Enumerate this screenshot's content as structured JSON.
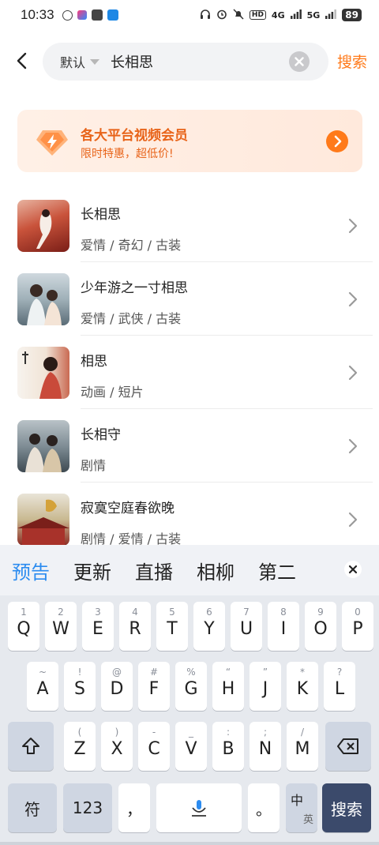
{
  "status": {
    "time": "10:33",
    "network1": "4G",
    "network2": "5G",
    "battery": "89"
  },
  "header": {
    "filter_label": "默认",
    "query": "长相思",
    "search_label": "搜索"
  },
  "banner": {
    "title": "各大平台视频会员",
    "subtitle": "限时特惠，超低价!"
  },
  "results": [
    {
      "title": "长相思",
      "tags": "爱情 / 奇幻 / 古装"
    },
    {
      "title": "少年游之一寸相思",
      "tags": "爱情 / 武侠 / 古装"
    },
    {
      "title": "相思",
      "tags": "动画 / 短片"
    },
    {
      "title": "长相守",
      "tags": "剧情"
    },
    {
      "title": "寂寞空庭春欲晚",
      "tags": "剧情 / 爱情 / 古装"
    }
  ],
  "suggestions": [
    "预告",
    "更新",
    "直播",
    "相柳",
    "第二"
  ],
  "keyboard": {
    "row1": [
      [
        "1",
        "Q"
      ],
      [
        "2",
        "W"
      ],
      [
        "3",
        "E"
      ],
      [
        "4",
        "R"
      ],
      [
        "5",
        "T"
      ],
      [
        "6",
        "Y"
      ],
      [
        "7",
        "U"
      ],
      [
        "8",
        "I"
      ],
      [
        "9",
        "O"
      ],
      [
        "0",
        "P"
      ]
    ],
    "row2": [
      [
        "~",
        "A"
      ],
      [
        "!",
        "S"
      ],
      [
        "@",
        "D"
      ],
      [
        "#",
        "F"
      ],
      [
        "%",
        "G"
      ],
      [
        "“",
        "H"
      ],
      [
        "”",
        "J"
      ],
      [
        "*",
        "K"
      ],
      [
        "?",
        "L"
      ]
    ],
    "row3": [
      [
        "(",
        "Z"
      ],
      [
        ")",
        "X"
      ],
      [
        "-",
        "C"
      ],
      [
        "_",
        "V"
      ],
      [
        ":",
        "B"
      ],
      [
        ";",
        "N"
      ],
      [
        "/",
        "M"
      ]
    ],
    "symbols_label": "符",
    "numbers_label": "123",
    "comma": "，",
    "period": "。",
    "lang_label_top": "中",
    "lang_label_bottom": "英",
    "enter_label": "搜索"
  },
  "colors": {
    "accent": "#ff7a1a",
    "suggestion_active": "#2c8cf0"
  }
}
